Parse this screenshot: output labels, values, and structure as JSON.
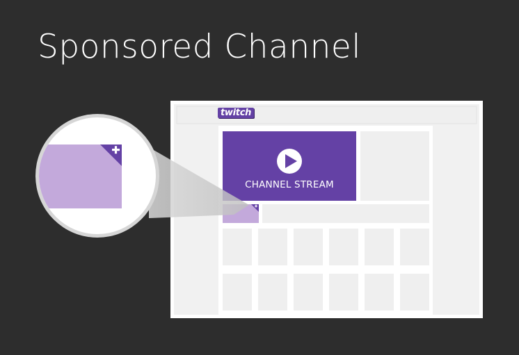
{
  "title": "Sponsored Channel",
  "logo_text": "twitch",
  "player": {
    "label": "CHANNEL STREAM",
    "icon": "play-icon"
  },
  "badge_icon": "plus-icon",
  "colors": {
    "background": "#2d2d2d",
    "brand_purple": "#6441a5",
    "sponsored_tile": "#c3a9db",
    "placeholder": "#efefef",
    "frame": "#ffffff"
  }
}
